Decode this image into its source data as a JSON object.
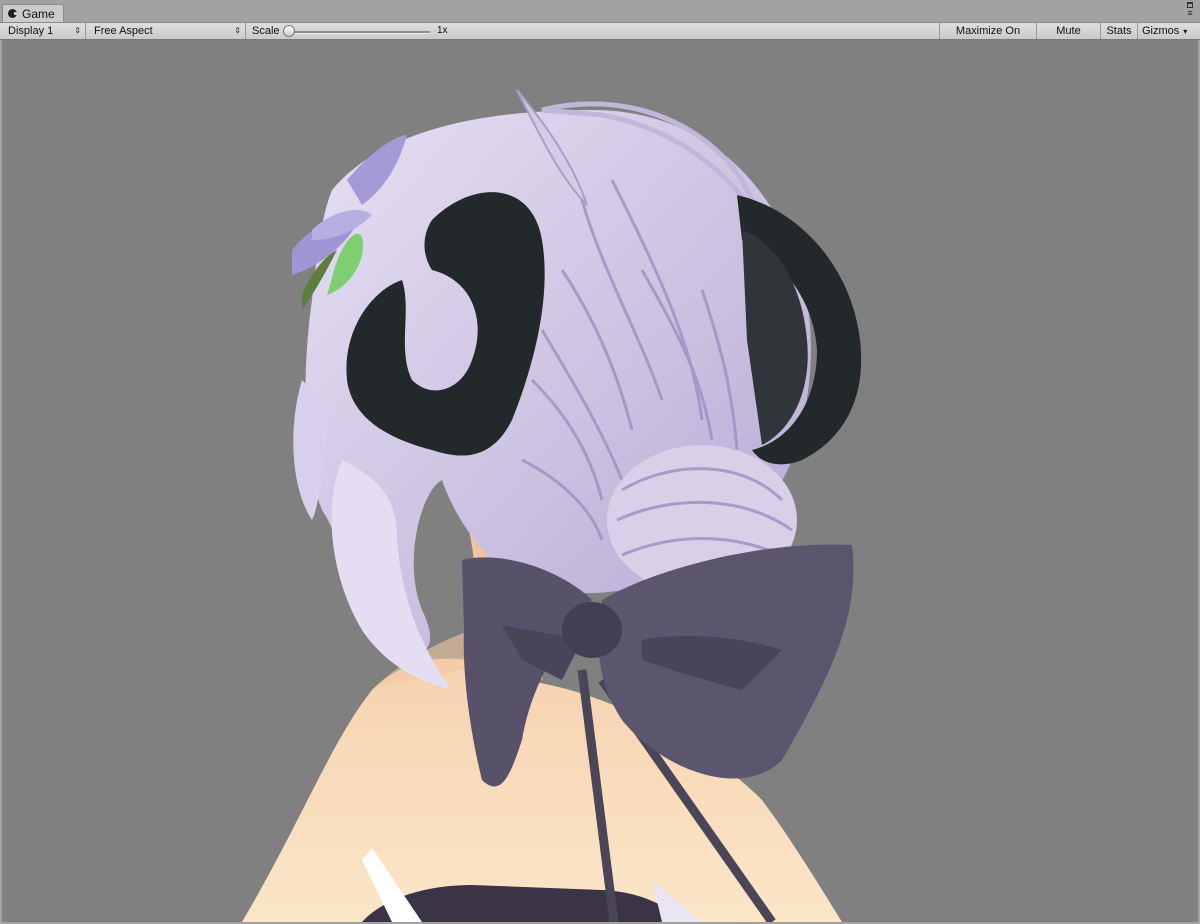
{
  "window": {
    "tab_label": "Game",
    "tab_icon": "unity-game-icon"
  },
  "toolbar": {
    "display": "Display 1",
    "aspect": "Free Aspect",
    "scale_label": "Scale",
    "scale_value": "1x",
    "scale_slider_fraction": 0.0,
    "maximize_on_play": "Maximize On Play",
    "mute_audio": "Mute Audio",
    "stats": "Stats",
    "gizmos": "Gizmos"
  },
  "viewport": {
    "background_color": "#808080",
    "content": "3D character model rendered in game view"
  },
  "colors": {
    "hair": "#c8bde0",
    "horns": "#23282b",
    "bow": "#5b566e",
    "skin": "#f8dcb9"
  }
}
